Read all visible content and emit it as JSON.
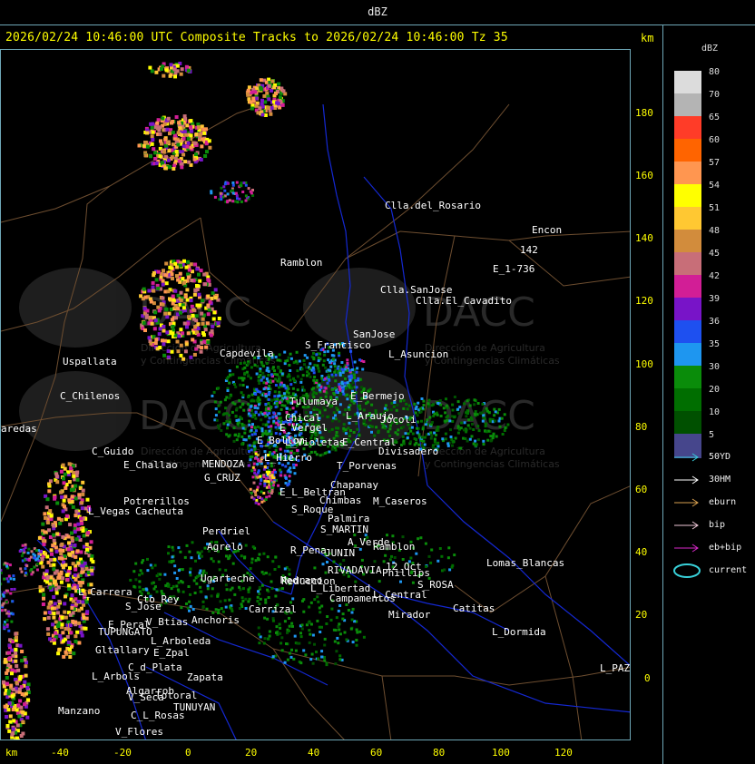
{
  "window": {
    "title": "dBZ"
  },
  "header": {
    "text": "2026/02/24 10:46:00 UTC Composite Tracks to 2026/02/24 10:46:00 Tz 35",
    "km_label": "km"
  },
  "axes": {
    "x_unit": "km",
    "y_ticks": [
      "180",
      "160",
      "140",
      "120",
      "100",
      "80",
      "60",
      "40",
      "20",
      "0"
    ],
    "x_ticks": [
      "-40",
      "-20",
      "0",
      "20",
      "40",
      "60",
      "80",
      "100",
      "120"
    ]
  },
  "places": [
    {
      "name": "Clla.del_Rosario"
    },
    {
      "name": "Encon"
    },
    {
      "name": "142"
    },
    {
      "name": "E_1-736"
    },
    {
      "name": "Ramblon"
    },
    {
      "name": "Clla.SanJose"
    },
    {
      "name": "Clla.El_Cavadito"
    },
    {
      "name": "SanJose"
    },
    {
      "name": "S_Francisco"
    },
    {
      "name": "L_Asuncion"
    },
    {
      "name": "Capdevila"
    },
    {
      "name": "Uspallata"
    },
    {
      "name": "C_Chilenos"
    },
    {
      "name": "aredas"
    },
    {
      "name": "Tulumaya"
    },
    {
      "name": "E_Bermejo"
    },
    {
      "name": "Chical"
    },
    {
      "name": "E_Vergel"
    },
    {
      "name": "L_Araujo"
    },
    {
      "name": "Jocoli"
    },
    {
      "name": "E_Bollon"
    },
    {
      "name": "L_Violetas"
    },
    {
      "name": "E_Central"
    },
    {
      "name": "Divisadero"
    },
    {
      "name": "C_Guido"
    },
    {
      "name": "E_Challao"
    },
    {
      "name": "L_Hierro"
    },
    {
      "name": "T_Porvenas"
    },
    {
      "name": "MENDOZA"
    },
    {
      "name": "G_CRUZ"
    },
    {
      "name": "Chapanay"
    },
    {
      "name": "Potrerillos"
    },
    {
      "name": "Cacheuta"
    },
    {
      "name": "E_L_Beltran"
    },
    {
      "name": "Chimbas"
    },
    {
      "name": "M_Caseros"
    },
    {
      "name": "L_Vegas"
    },
    {
      "name": "S_Roque"
    },
    {
      "name": "Palmira"
    },
    {
      "name": "S_MARTIN"
    },
    {
      "name": "Perdriel"
    },
    {
      "name": "A_Verde"
    },
    {
      "name": "Ramblon"
    },
    {
      "name": "Agrelo"
    },
    {
      "name": "R_Pena"
    },
    {
      "name": "JUNIN"
    },
    {
      "name": "Ugarteche"
    },
    {
      "name": "Medrano"
    },
    {
      "name": "RIVADAVIA"
    },
    {
      "name": "12_Oct"
    },
    {
      "name": "Phillips"
    },
    {
      "name": "Lomas_Blancas"
    },
    {
      "name": "Reduccion"
    },
    {
      "name": "L_Libertad"
    },
    {
      "name": "Campamentos"
    },
    {
      "name": "S_ROSA"
    },
    {
      "name": "L_Carrera"
    },
    {
      "name": "Cto_Rey"
    },
    {
      "name": "L_Central"
    },
    {
      "name": "S_Jose"
    },
    {
      "name": "Catitas"
    },
    {
      "name": "Carrizal"
    },
    {
      "name": "Anchoris"
    },
    {
      "name": "Mirador"
    },
    {
      "name": "E_Peral"
    },
    {
      "name": "V_Btias"
    },
    {
      "name": "TUPUNGATO"
    },
    {
      "name": "L_Dormida"
    },
    {
      "name": "L_Arboleda"
    },
    {
      "name": "Gltallary"
    },
    {
      "name": "E_Zpal"
    },
    {
      "name": "C_d_Plata"
    },
    {
      "name": "L_Arbols"
    },
    {
      "name": "Zapata"
    },
    {
      "name": "L_PAZ"
    },
    {
      "name": "Algarrob"
    },
    {
      "name": "V_Seca"
    },
    {
      "name": "Totoral"
    },
    {
      "name": "TUNUYAN"
    },
    {
      "name": "Manzano"
    },
    {
      "name": "C_L_Rosas"
    },
    {
      "name": "V_Flores"
    }
  ],
  "watermark": {
    "title": "DACC",
    "line1": "Dirección de Agricultura",
    "line2": "y Contingencias Climáticas"
  },
  "legend": {
    "title": "dBZ",
    "scale": [
      {
        "value": "80",
        "color": "#dcdcdc"
      },
      {
        "value": "70",
        "color": "#b4b4b4"
      },
      {
        "value": "65",
        "color": "#ff3c28"
      },
      {
        "value": "60",
        "color": "#ff6400"
      },
      {
        "value": "57",
        "color": "#ff9650"
      },
      {
        "value": "54",
        "color": "#ffff00"
      },
      {
        "value": "51",
        "color": "#ffc832"
      },
      {
        "value": "48",
        "color": "#d28c3c"
      },
      {
        "value": "45",
        "color": "#c86e78"
      },
      {
        "value": "42",
        "color": "#d21e96"
      },
      {
        "value": "39",
        "color": "#7814c8"
      },
      {
        "value": "36",
        "color": "#1e50f0"
      },
      {
        "value": "35",
        "color": "#1e96f0"
      },
      {
        "value": "30",
        "color": "#0a8c0a"
      },
      {
        "value": "20",
        "color": "#006e00"
      },
      {
        "value": "10",
        "color": "#005000"
      },
      {
        "value": "5",
        "color": "#46468c"
      }
    ],
    "tracks": [
      {
        "label": "50YD",
        "color": "#38c8d8"
      },
      {
        "label": "30HM",
        "color": "#ffffff"
      },
      {
        "label": "eburn",
        "color": "#d8a050"
      },
      {
        "label": "bip",
        "color": "#f0c8d8"
      },
      {
        "label": "eb+bip",
        "color": "#d828c8"
      },
      {
        "label": "current",
        "color": "#38d0d8"
      }
    ]
  }
}
